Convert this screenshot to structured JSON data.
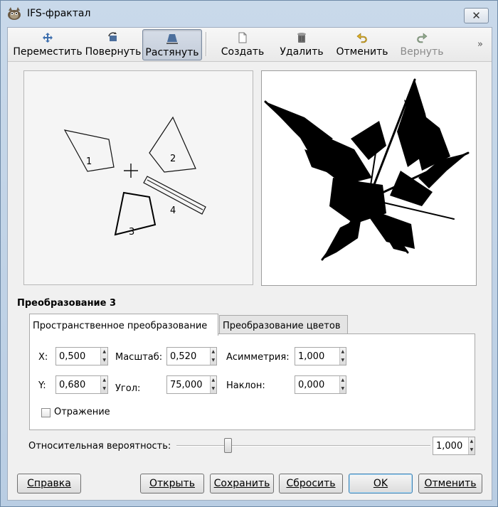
{
  "window": {
    "title": "IFS-фрактал",
    "close_label": "✕"
  },
  "toolbar": {
    "items": [
      {
        "label": "Переместить",
        "icon": "move-icon"
      },
      {
        "label": "Повернуть",
        "icon": "rotate-icon"
      },
      {
        "label": "Растянуть",
        "icon": "stretch-icon",
        "active": true
      },
      {
        "label": "Создать",
        "icon": "new-icon"
      },
      {
        "label": "Удалить",
        "icon": "delete-icon"
      },
      {
        "label": "Отменить",
        "icon": "undo-icon"
      },
      {
        "label": "Вернуть",
        "icon": "redo-icon",
        "disabled": true
      }
    ],
    "overflow": "»"
  },
  "design": {
    "shape_labels": [
      "1",
      "2",
      "3",
      "4"
    ]
  },
  "transform": {
    "heading": "Преобразование 3",
    "tabs": [
      "Пространственное преобразование",
      "Преобразование цветов"
    ],
    "fields": {
      "x": {
        "label": "X:",
        "value": "0,500"
      },
      "y": {
        "label": "Y:",
        "value": "0,680"
      },
      "scale": {
        "label": "Масштаб:",
        "value": "0,520"
      },
      "angle": {
        "label": "Угол:",
        "value": "75,000"
      },
      "asym": {
        "label": "Асимметрия:",
        "value": "1,000"
      },
      "shear": {
        "label": "Наклон:",
        "value": "0,000"
      }
    },
    "flip_label": "Отражение"
  },
  "probability": {
    "label": "Относительная вероятность:",
    "value": "1,000",
    "level": 0.19
  },
  "buttons": {
    "help": "Справка",
    "open": "Открыть",
    "save": "Сохранить",
    "reset": "Сбросить",
    "ok": "OK",
    "cancel": "Отменить"
  },
  "colors": {
    "accent": "#3c7fb1",
    "title_bar": "#c9d9ea"
  }
}
